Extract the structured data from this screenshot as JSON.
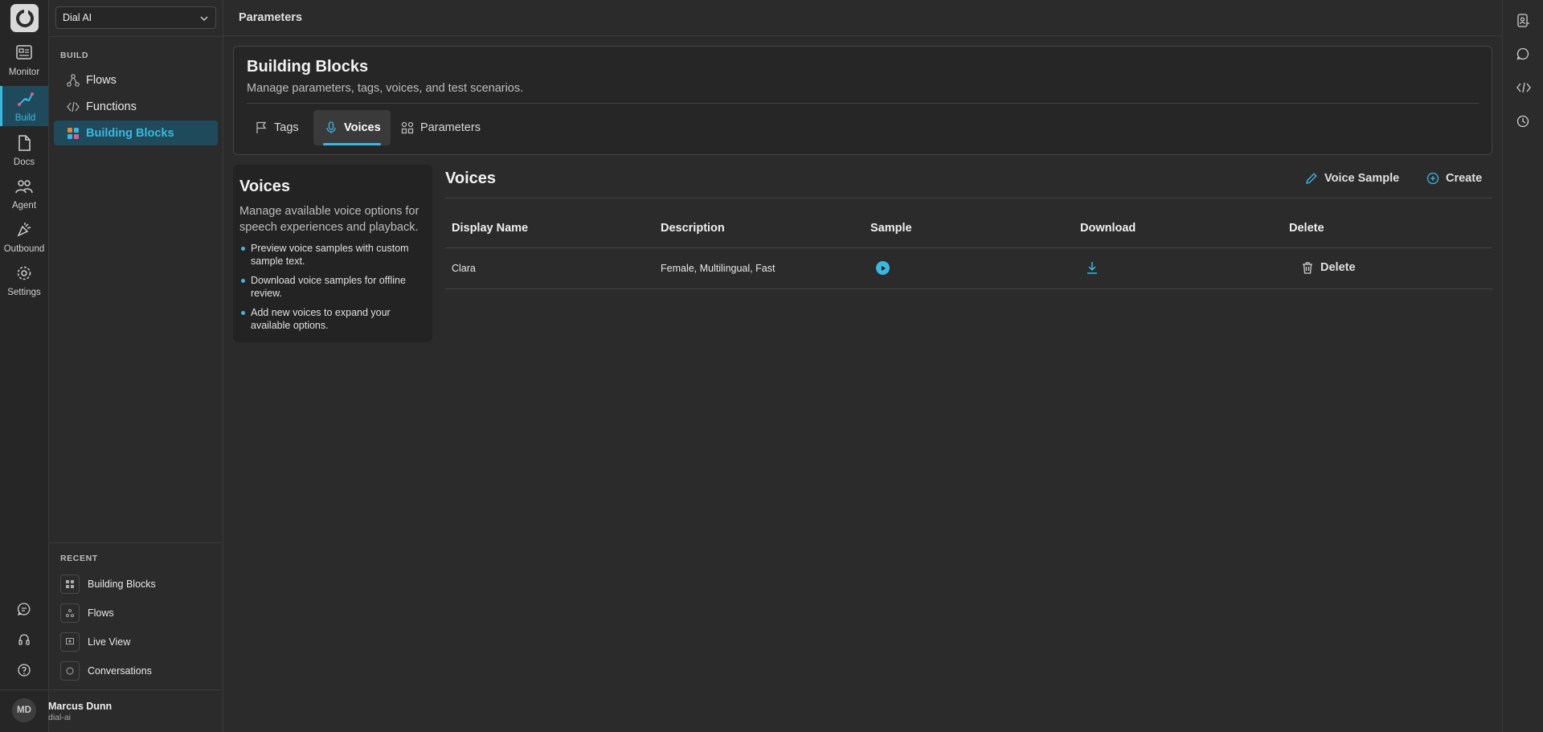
{
  "workspace": {
    "selected": "Dial AI"
  },
  "rail": {
    "items": [
      {
        "label": "Monitor",
        "icon": "monitor-icon"
      },
      {
        "label": "Build",
        "icon": "build-icon"
      },
      {
        "label": "Docs",
        "icon": "docs-icon"
      },
      {
        "label": "Agent",
        "icon": "agent-icon"
      },
      {
        "label": "Outbound",
        "icon": "outbound-icon"
      },
      {
        "label": "Settings",
        "icon": "gear-icon"
      }
    ],
    "bottom_icons": [
      "chat-icon",
      "headset-icon",
      "help-icon"
    ]
  },
  "sidebar": {
    "section_label": "BUILD",
    "items": [
      {
        "label": "Flows",
        "icon": "flows-icon"
      },
      {
        "label": "Functions",
        "icon": "code-icon"
      },
      {
        "label": "Building Blocks",
        "icon": "blocks-icon"
      }
    ],
    "recent_label": "RECENT",
    "recent": [
      {
        "label": "Building Blocks",
        "icon": "blocks-icon"
      },
      {
        "label": "Flows",
        "icon": "flows-icon"
      },
      {
        "label": "Live View",
        "icon": "live-view-icon"
      },
      {
        "label": "Conversations",
        "icon": "chat-icon"
      }
    ]
  },
  "user": {
    "initials": "MD",
    "name": "Marcus Dunn",
    "handle": "dial-ai"
  },
  "topbar": {
    "title": "Parameters"
  },
  "header": {
    "title": "Building Blocks",
    "subtitle": "Manage parameters, tags, voices, and test scenarios.",
    "tabs": [
      {
        "label": "Tags",
        "icon": "flag-icon"
      },
      {
        "label": "Voices",
        "icon": "microphone-icon"
      },
      {
        "label": "Parameters",
        "icon": "parameters-icon"
      }
    ]
  },
  "info": {
    "title": "Voices",
    "description": "Manage available voice options for speech experiences and playback.",
    "bullets": [
      "Preview voice samples with custom sample text.",
      "Download voice samples for offline review.",
      "Add new voices to expand your available options."
    ]
  },
  "voices": {
    "title": "Voices",
    "actions": {
      "voice_sample": "Voice Sample",
      "create": "Create"
    },
    "columns": [
      "Display Name",
      "Description",
      "Sample",
      "Download",
      "Delete"
    ],
    "rows": [
      {
        "display_name": "Clara",
        "description": "Female, Multilingual, Fast",
        "delete_label": "Delete"
      }
    ]
  },
  "colors": {
    "accent": "#3bb8e0",
    "background": "#2b2b2b",
    "active_bg": "#1f4a5c"
  }
}
